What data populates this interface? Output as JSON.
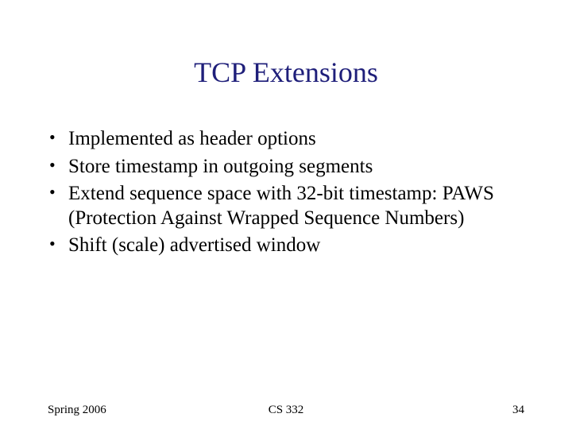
{
  "title": "TCP Extensions",
  "bullets": [
    "Implemented as header options",
    "Store timestamp in outgoing segments",
    "Extend sequence space with  32-bit timestamp: PAWS (Protection Against Wrapped Sequence Numbers)",
    "Shift (scale) advertised window"
  ],
  "footer": {
    "left": "Spring 2006",
    "center": "CS 332",
    "right": "34"
  }
}
